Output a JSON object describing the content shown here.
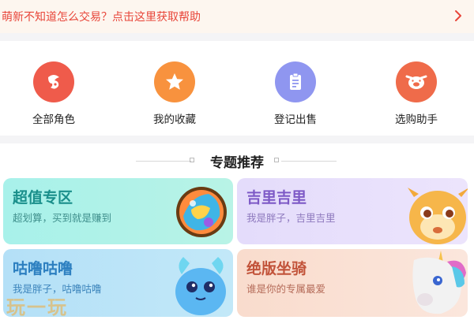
{
  "banner": {
    "text": "萌新不知道怎么交易？点击这里获取帮助",
    "chevron_icon": "chevron-right-icon",
    "color": "#e8463a"
  },
  "quick_actions": [
    {
      "label": "全部角色",
      "icon": "role-icon",
      "color": "#ef5b4b"
    },
    {
      "label": "我的收藏",
      "icon": "star-icon",
      "color": "#f8923e"
    },
    {
      "label": "登记出售",
      "icon": "clipboard-icon",
      "color": "#8f96f0"
    },
    {
      "label": "选购助手",
      "icon": "pig-icon",
      "color": "#ef6b4a"
    }
  ],
  "section": {
    "title": "专题推荐"
  },
  "cards": [
    {
      "title": "超值专区",
      "subtitle": "超划算，买到就是赚到",
      "title_color": "#1a8f8b",
      "sub_color": "#3f8f8c",
      "bg": "#a6f1ea"
    },
    {
      "title": "吉里吉里",
      "subtitle": "我是胖子，吉里吉里",
      "title_color": "#7d59c6",
      "sub_color": "#8d78bd",
      "bg": "#e5dcfb"
    },
    {
      "title": "咕噜咕噜",
      "subtitle": "我是胖子，咕噜咕噜",
      "title_color": "#2c7fc0",
      "sub_color": "#3c84bb",
      "bg": "#b6e2f7"
    },
    {
      "title": "绝版坐骑",
      "subtitle": "谁是你的专属最爱",
      "title_color": "#c2533a",
      "sub_color": "#b46a58",
      "bg": "#f9ddd0"
    }
  ],
  "watermark": {
    "text": "玩一玩"
  }
}
